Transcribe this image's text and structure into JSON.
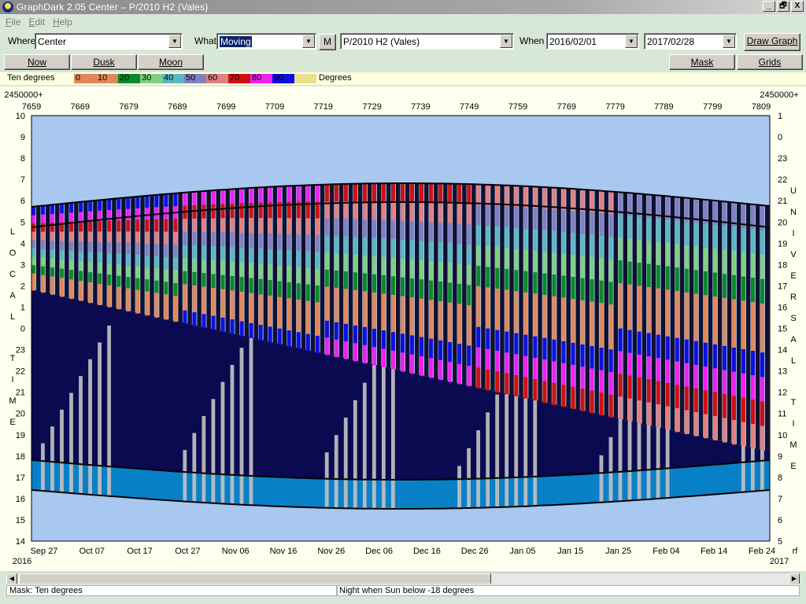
{
  "window": {
    "title": "GraphDark 2.05  Center  –  P/2010 H2 (Vales)",
    "buttons": [
      "_",
      "🗗",
      "X"
    ]
  },
  "menu": [
    {
      "label": "File",
      "key": "F",
      "rest": "ile"
    },
    {
      "label": "Edit",
      "key": "E",
      "rest": "dit"
    },
    {
      "label": "Help",
      "key": "H",
      "rest": "elp"
    }
  ],
  "toolbar": {
    "where_label": "Where",
    "where_value": "Center",
    "what_label": "What",
    "what_value": "Moving",
    "m_button": "M",
    "object_value": "P/2010 H2 (Vales)",
    "when_label": "When",
    "start_date": "2016/02/01",
    "end_date": "2017/02/28",
    "draw_button": "Draw Graph"
  },
  "toolbar2": {
    "now": "Now",
    "dusk": "Dusk",
    "moon": "Moon",
    "mask": "Mask",
    "grids": "Grids"
  },
  "legend": {
    "title": "Ten degrees",
    "unit": "Degrees",
    "levels": [
      {
        "label": "0",
        "color": "#e0885a"
      },
      {
        "label": "10",
        "color": "#e0885a"
      },
      {
        "label": "20",
        "color": "#0a8a2a"
      },
      {
        "label": "30",
        "color": "#80d080"
      },
      {
        "label": "40",
        "color": "#5ab8c0"
      },
      {
        "label": "50",
        "color": "#8080c0"
      },
      {
        "label": "60",
        "color": "#e08080"
      },
      {
        "label": "70",
        "color": "#d01010"
      },
      {
        "label": "80",
        "color": "#f020f0"
      },
      {
        "label": "90",
        "color": "#1010e0"
      },
      {
        "label": "",
        "color": "#e8e090"
      }
    ]
  },
  "chart_data": {
    "type": "heatmap",
    "title": "",
    "top_axis_prefix_left": "2450000+",
    "top_axis_prefix_right": "2450000+",
    "top_ticks": [
      "7659",
      "7669",
      "7679",
      "7689",
      "7699",
      "7709",
      "7719",
      "7729",
      "7739",
      "7749",
      "7759",
      "7769",
      "7779",
      "7789",
      "7799",
      "7809"
    ],
    "bottom_ticks": [
      "Sep 27",
      "Oct 07",
      "Oct 17",
      "Oct 27",
      "Nov 06",
      "Nov 16",
      "Nov 26",
      "Dec 06",
      "Dec 16",
      "Dec 26",
      "Jan 05",
      "Jan 15",
      "Jan 25",
      "Feb 04",
      "Feb 14",
      "Feb 24"
    ],
    "bottom_year_left": "2016",
    "bottom_year_right": "2017",
    "bottom_right_mark": "rf",
    "left_ticks": [
      "10",
      "9",
      "8",
      "7",
      "6",
      "5",
      "4",
      "3",
      "2",
      "1",
      "0",
      "23",
      "22",
      "21",
      "20",
      "19",
      "18",
      "17",
      "16",
      "15",
      "14"
    ],
    "right_ticks": [
      "1",
      "0",
      "23",
      "22",
      "21",
      "20",
      "19",
      "18",
      "17",
      "16",
      "15",
      "14",
      "13",
      "12",
      "11",
      "10",
      "9",
      "8",
      "7",
      "6",
      "5"
    ],
    "left_axis_label": "LOCAL TIME",
    "right_axis_label": "UNIVERSAL TIME",
    "colors": {
      "sky": "#a8c8f0",
      "night": "#0a0a50",
      "twilight": "#0880c8",
      "moon": "#c0c0c0"
    }
  },
  "status": {
    "mask": "Mask:  Ten degrees",
    "night": "Night when Sun below -18 degrees"
  }
}
